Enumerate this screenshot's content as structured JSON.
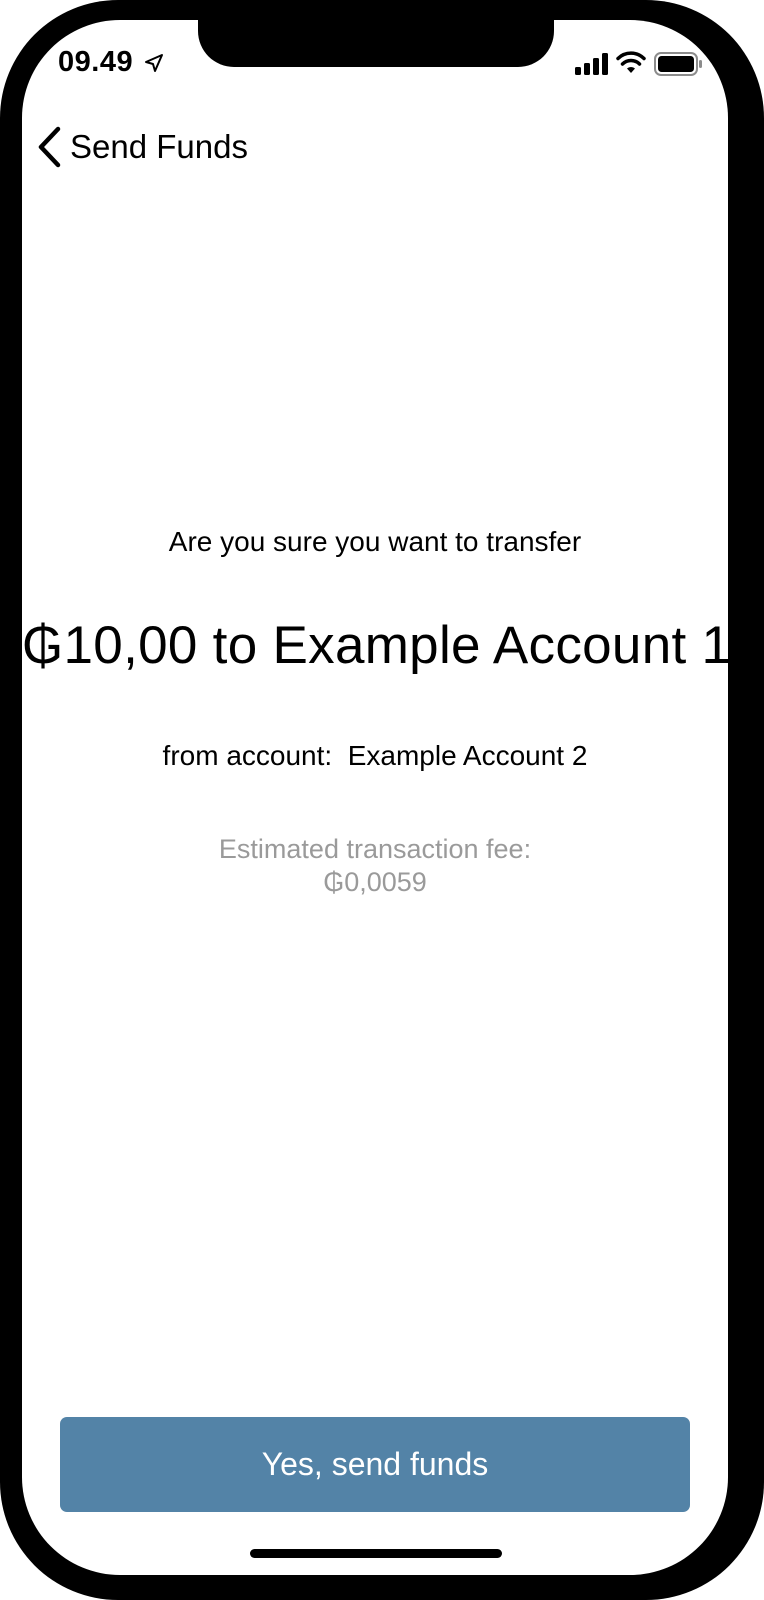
{
  "status_bar": {
    "time": "09.49",
    "location_icon": "location-arrow-icon",
    "signal_icon": "cellular-signal-icon",
    "wifi_icon": "wifi-icon",
    "battery_icon": "battery-icon"
  },
  "nav": {
    "back_icon": "chevron-left-icon",
    "title": "Send Funds"
  },
  "confirm": {
    "question": "Are you sure you want to transfer",
    "amount_line": "₲10,00 to Example Account 1",
    "from_line": "from account:  Example Account 2",
    "fee_label": "Estimated transaction fee:",
    "fee_value": "₲0,0059"
  },
  "actions": {
    "send_label": "Yes, send funds"
  },
  "colors": {
    "accent": "#5383a7",
    "muted_text": "#9a9a9a",
    "frame": "#000000"
  }
}
